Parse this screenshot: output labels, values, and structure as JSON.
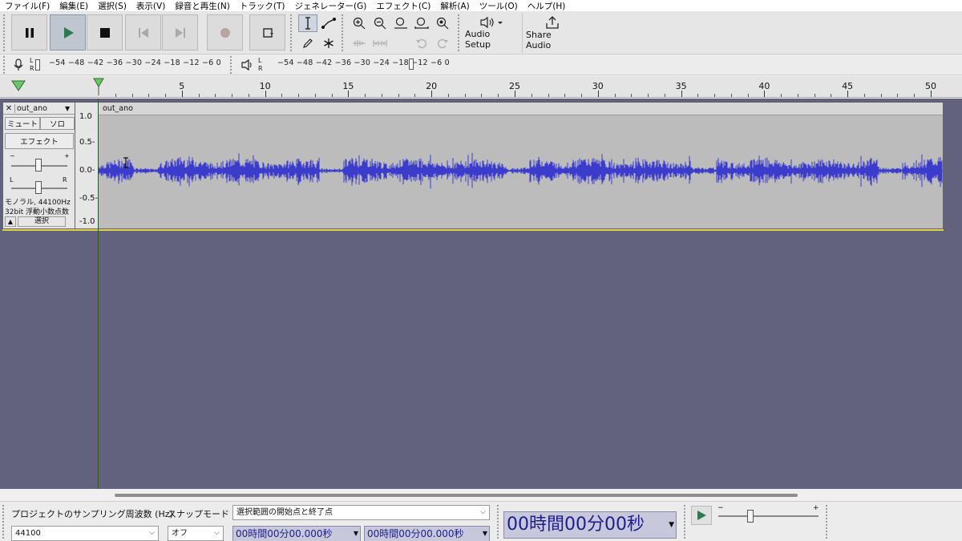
{
  "menu": [
    "ファイル(F)",
    "編集(E)",
    "選択(S)",
    "表示(V)",
    "録音と再生(N)",
    "トラック(T)",
    "ジェネレーター(G)",
    "エフェクト(C)",
    "解析(A)",
    "ツール(O)",
    "ヘルプ(H)"
  ],
  "toolbar": {
    "audio_setup": "Audio Setup",
    "share_audio": "Share Audio"
  },
  "meters": {
    "record_scale": "−54 −48 −42 −36 −30 −24 −18 −12 −6 0",
    "play_scale": "−54 −48 −42 −36 −30 −24 −18 −12 −6 0",
    "l": "L",
    "r": "R"
  },
  "ruler": {
    "ticks": [
      "5",
      "10",
      "15",
      "20",
      "25",
      "30",
      "35",
      "40",
      "45",
      "50"
    ]
  },
  "track": {
    "name": "out_ano",
    "clip_name": "out_ano",
    "mute": "ミュート",
    "solo": "ソロ",
    "effect": "エフェクト",
    "gain_minus": "−",
    "gain_plus": "+",
    "pan_l": "L",
    "pan_r": "R",
    "info1": "モノラル, 44100Hz",
    "info2": "32bit 浮動小数点数",
    "select": "選択",
    "y_labels": [
      "1.0",
      "0.5-",
      "0.0-",
      "-0.5-",
      "-1.0"
    ]
  },
  "selection": {
    "rate_label": "プロジェクトのサンプリング周波数 (Hz)",
    "rate_value": "44100",
    "snap_label": "スナップモード",
    "snap_value": "オフ",
    "range_label": "選択範囲の開始点と終了点",
    "start_time": "00時間00分00.000秒",
    "end_time": "00時間00分00.000秒",
    "big_time": "00時間00分00秒",
    "speed_minus": "−",
    "speed_plus": "+"
  },
  "colors": {
    "waveform": "#3b3bcc",
    "track_bg": "#62627e",
    "time_text": "#1d1d8c"
  }
}
